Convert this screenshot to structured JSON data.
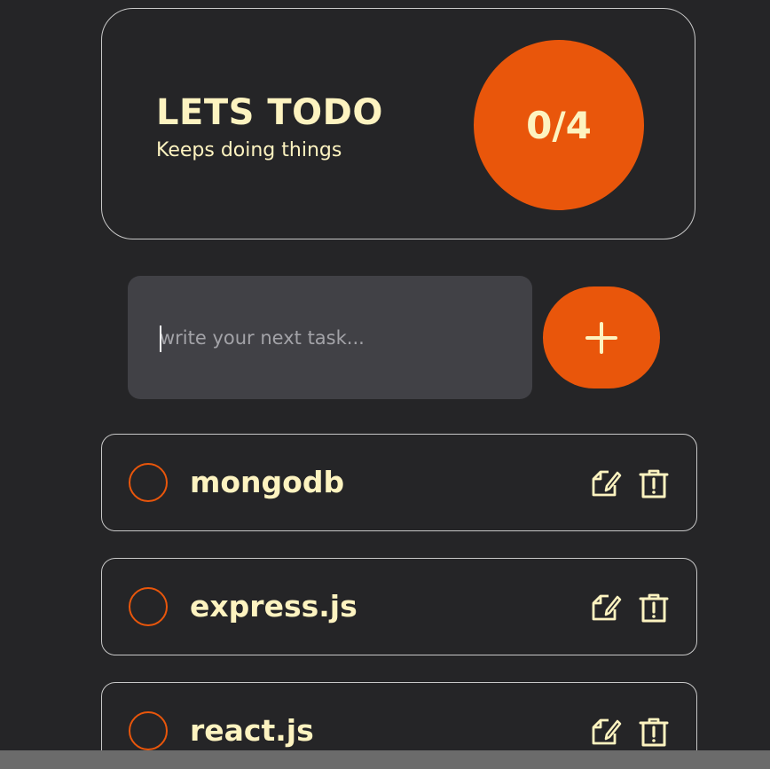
{
  "header": {
    "title": "LETS TODO",
    "subtitle": "Keeps doing things",
    "progress": "0/4"
  },
  "new_task": {
    "value": "",
    "placeholder": "write your next task...",
    "add_icon": "plus-icon"
  },
  "todos": [
    {
      "text": "mongodb",
      "completed": false
    },
    {
      "text": "express.js",
      "completed": false
    },
    {
      "text": "react.js",
      "completed": false
    }
  ],
  "icons": {
    "edit": "edit-icon",
    "delete": "trash-icon"
  },
  "colors": {
    "background": "#252527",
    "accent": "#e9560b",
    "text": "#fdf3c0",
    "input_background": "#414146",
    "border": "#c8c8c8"
  }
}
